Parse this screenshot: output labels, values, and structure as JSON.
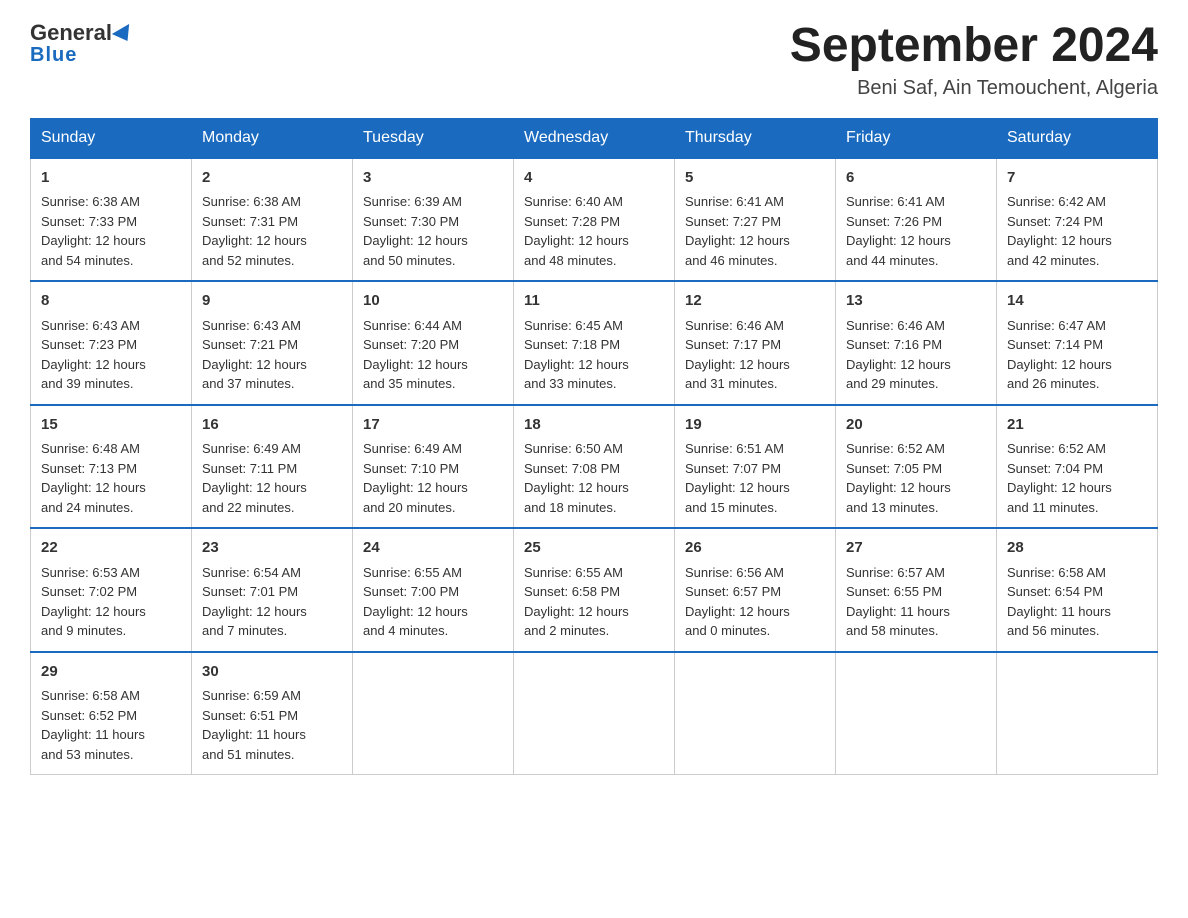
{
  "header": {
    "logo_general": "General",
    "logo_blue": "Blue",
    "month_year": "September 2024",
    "location": "Beni Saf, Ain Temouchent, Algeria"
  },
  "days_of_week": [
    "Sunday",
    "Monday",
    "Tuesday",
    "Wednesday",
    "Thursday",
    "Friday",
    "Saturday"
  ],
  "weeks": [
    [
      {
        "day": "1",
        "sunrise": "6:38 AM",
        "sunset": "7:33 PM",
        "daylight": "12 hours and 54 minutes."
      },
      {
        "day": "2",
        "sunrise": "6:38 AM",
        "sunset": "7:31 PM",
        "daylight": "12 hours and 52 minutes."
      },
      {
        "day": "3",
        "sunrise": "6:39 AM",
        "sunset": "7:30 PM",
        "daylight": "12 hours and 50 minutes."
      },
      {
        "day": "4",
        "sunrise": "6:40 AM",
        "sunset": "7:28 PM",
        "daylight": "12 hours and 48 minutes."
      },
      {
        "day": "5",
        "sunrise": "6:41 AM",
        "sunset": "7:27 PM",
        "daylight": "12 hours and 46 minutes."
      },
      {
        "day": "6",
        "sunrise": "6:41 AM",
        "sunset": "7:26 PM",
        "daylight": "12 hours and 44 minutes."
      },
      {
        "day": "7",
        "sunrise": "6:42 AM",
        "sunset": "7:24 PM",
        "daylight": "12 hours and 42 minutes."
      }
    ],
    [
      {
        "day": "8",
        "sunrise": "6:43 AM",
        "sunset": "7:23 PM",
        "daylight": "12 hours and 39 minutes."
      },
      {
        "day": "9",
        "sunrise": "6:43 AM",
        "sunset": "7:21 PM",
        "daylight": "12 hours and 37 minutes."
      },
      {
        "day": "10",
        "sunrise": "6:44 AM",
        "sunset": "7:20 PM",
        "daylight": "12 hours and 35 minutes."
      },
      {
        "day": "11",
        "sunrise": "6:45 AM",
        "sunset": "7:18 PM",
        "daylight": "12 hours and 33 minutes."
      },
      {
        "day": "12",
        "sunrise": "6:46 AM",
        "sunset": "7:17 PM",
        "daylight": "12 hours and 31 minutes."
      },
      {
        "day": "13",
        "sunrise": "6:46 AM",
        "sunset": "7:16 PM",
        "daylight": "12 hours and 29 minutes."
      },
      {
        "day": "14",
        "sunrise": "6:47 AM",
        "sunset": "7:14 PM",
        "daylight": "12 hours and 26 minutes."
      }
    ],
    [
      {
        "day": "15",
        "sunrise": "6:48 AM",
        "sunset": "7:13 PM",
        "daylight": "12 hours and 24 minutes."
      },
      {
        "day": "16",
        "sunrise": "6:49 AM",
        "sunset": "7:11 PM",
        "daylight": "12 hours and 22 minutes."
      },
      {
        "day": "17",
        "sunrise": "6:49 AM",
        "sunset": "7:10 PM",
        "daylight": "12 hours and 20 minutes."
      },
      {
        "day": "18",
        "sunrise": "6:50 AM",
        "sunset": "7:08 PM",
        "daylight": "12 hours and 18 minutes."
      },
      {
        "day": "19",
        "sunrise": "6:51 AM",
        "sunset": "7:07 PM",
        "daylight": "12 hours and 15 minutes."
      },
      {
        "day": "20",
        "sunrise": "6:52 AM",
        "sunset": "7:05 PM",
        "daylight": "12 hours and 13 minutes."
      },
      {
        "day": "21",
        "sunrise": "6:52 AM",
        "sunset": "7:04 PM",
        "daylight": "12 hours and 11 minutes."
      }
    ],
    [
      {
        "day": "22",
        "sunrise": "6:53 AM",
        "sunset": "7:02 PM",
        "daylight": "12 hours and 9 minutes."
      },
      {
        "day": "23",
        "sunrise": "6:54 AM",
        "sunset": "7:01 PM",
        "daylight": "12 hours and 7 minutes."
      },
      {
        "day": "24",
        "sunrise": "6:55 AM",
        "sunset": "7:00 PM",
        "daylight": "12 hours and 4 minutes."
      },
      {
        "day": "25",
        "sunrise": "6:55 AM",
        "sunset": "6:58 PM",
        "daylight": "12 hours and 2 minutes."
      },
      {
        "day": "26",
        "sunrise": "6:56 AM",
        "sunset": "6:57 PM",
        "daylight": "12 hours and 0 minutes."
      },
      {
        "day": "27",
        "sunrise": "6:57 AM",
        "sunset": "6:55 PM",
        "daylight": "11 hours and 58 minutes."
      },
      {
        "day": "28",
        "sunrise": "6:58 AM",
        "sunset": "6:54 PM",
        "daylight": "11 hours and 56 minutes."
      }
    ],
    [
      {
        "day": "29",
        "sunrise": "6:58 AM",
        "sunset": "6:52 PM",
        "daylight": "11 hours and 53 minutes."
      },
      {
        "day": "30",
        "sunrise": "6:59 AM",
        "sunset": "6:51 PM",
        "daylight": "11 hours and 51 minutes."
      },
      null,
      null,
      null,
      null,
      null
    ]
  ],
  "labels": {
    "sunrise": "Sunrise:",
    "sunset": "Sunset:",
    "daylight": "Daylight:"
  }
}
